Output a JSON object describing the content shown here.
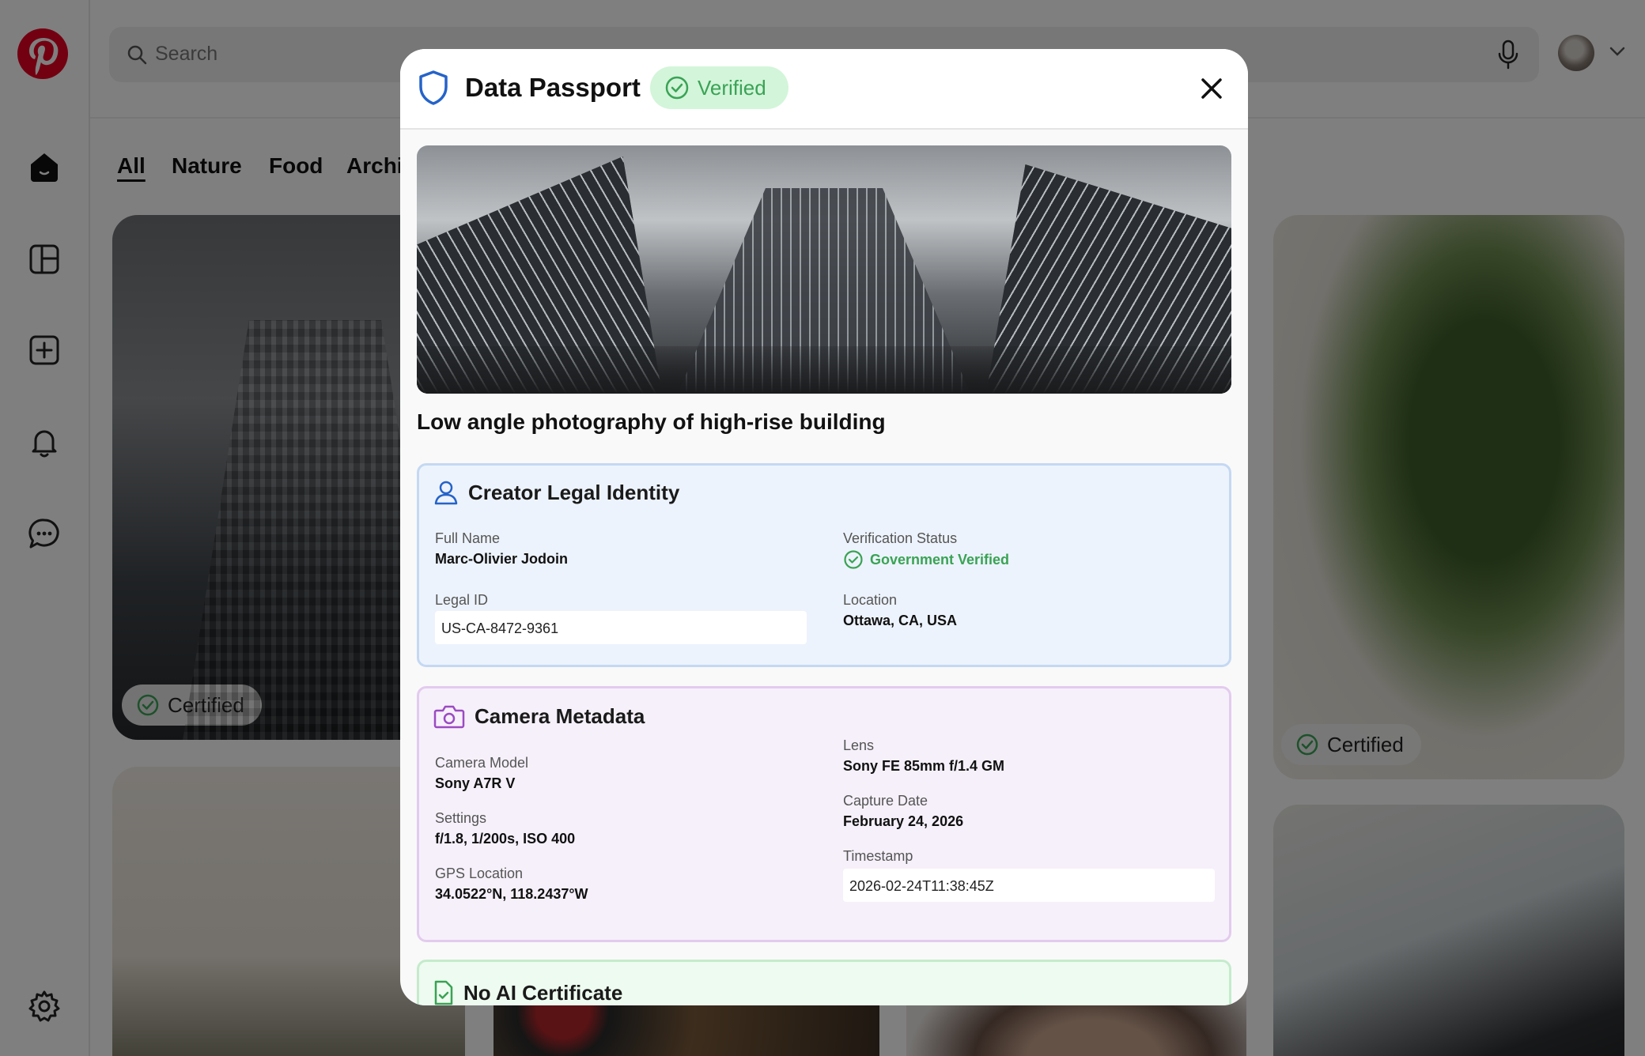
{
  "search": {
    "placeholder": "Search"
  },
  "tabs": [
    {
      "label": "All"
    },
    {
      "label": "Nature"
    },
    {
      "label": "Food"
    },
    {
      "label": "Archi"
    }
  ],
  "pins": [
    {
      "badge": "Certified"
    },
    {
      "badge": "Certified"
    }
  ],
  "modal": {
    "title": "Data Passport",
    "status_badge": "Verified",
    "photo_title": "Low angle photography of high-rise building",
    "creator": {
      "heading": "Creator Legal Identity",
      "full_name_label": "Full Name",
      "full_name": "Marc-Olivier Jodoin",
      "verification_label": "Verification Status",
      "verification_value": "Government Verified",
      "legal_id_label": "Legal ID",
      "legal_id": "US-CA-8472-9361",
      "location_label": "Location",
      "location": "Ottawa, CA, USA"
    },
    "camera": {
      "heading": "Camera Metadata",
      "model_label": "Camera Model",
      "model": "Sony A7R V",
      "lens_label": "Lens",
      "lens": "Sony FE 85mm f/1.4 GM",
      "settings_label": "Settings",
      "settings": "f/1.8, 1/200s, ISO 400",
      "capture_date_label": "Capture Date",
      "capture_date": "February 24, 2026",
      "gps_label": "GPS Location",
      "gps": "34.0522°N, 118.2437°W",
      "timestamp_label": "Timestamp",
      "timestamp": "2026-02-24T11:38:45Z"
    },
    "ai_certificate": {
      "heading": "No AI Certificate"
    }
  },
  "colors": {
    "brand": "#e60023",
    "verified_green": "#3aa356",
    "shield_blue": "#2563c9",
    "camera_purple": "#9b4bc2"
  }
}
